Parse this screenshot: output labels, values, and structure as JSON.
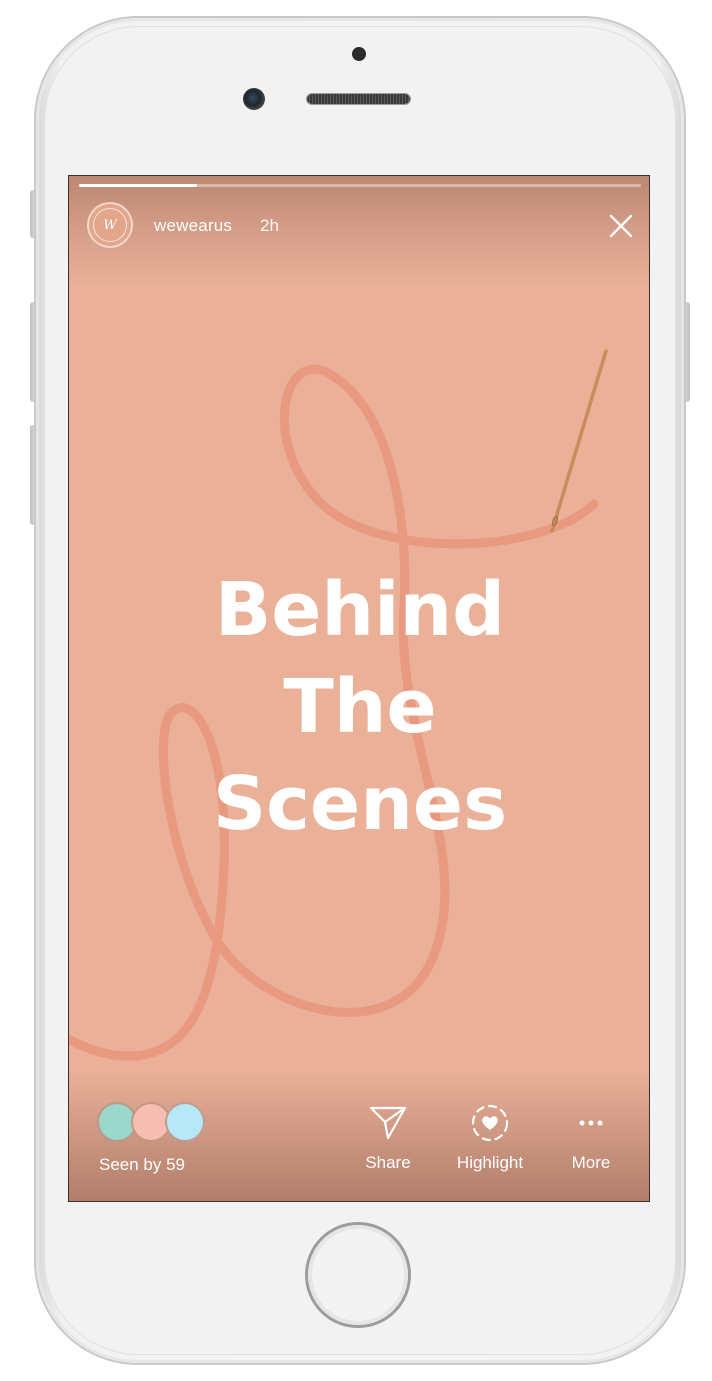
{
  "story": {
    "username": "wewearus",
    "time_ago": "2h",
    "avatar_letter": "W",
    "progress": 0.21,
    "title_lines": [
      "Behind",
      "The",
      "Scenes"
    ],
    "background_color": "#eab098",
    "thread_color": "#e8957a"
  },
  "footer": {
    "seen_label": "Seen by 59",
    "viewer_colors": [
      "#9ad8cc",
      "#f6beb0",
      "#b6e8f8"
    ],
    "actions": [
      {
        "label": "Share",
        "icon": "paper-plane-icon"
      },
      {
        "label": "Highlight",
        "icon": "heart-circle-icon"
      },
      {
        "label": "More",
        "icon": "ellipsis-icon"
      }
    ]
  },
  "icons": {
    "close": "close-icon"
  }
}
